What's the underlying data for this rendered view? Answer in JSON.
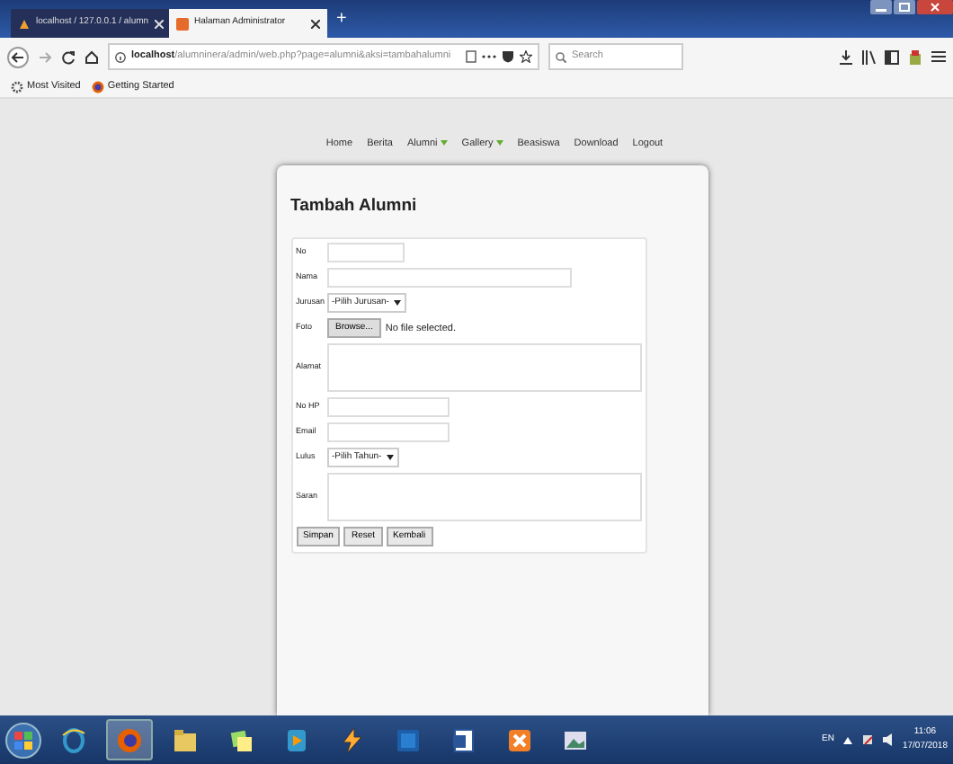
{
  "browser": {
    "tabs": [
      {
        "title": "localhost / 127.0.0.1 / alumn",
        "selected": false
      },
      {
        "title": "Halaman Administrator",
        "selected": true
      }
    ],
    "new_tab": "+",
    "address": {
      "host": "localhost",
      "path": "/alumninera/admin/web.php?page=alumni&aksi=tambahalumni"
    },
    "search": {
      "placeholder": "Search"
    },
    "bookmarks": [
      "Most Visited",
      "Getting Started"
    ]
  },
  "nav": [
    {
      "label": "Home",
      "dropdown": false
    },
    {
      "label": "Berita",
      "dropdown": false
    },
    {
      "label": "Alumni",
      "dropdown": true
    },
    {
      "label": "Gallery",
      "dropdown": true
    },
    {
      "label": "Beasiswa",
      "dropdown": false
    },
    {
      "label": "Download",
      "dropdown": false
    },
    {
      "label": "Logout",
      "dropdown": false
    }
  ],
  "form": {
    "title": "Tambah Alumni",
    "fields": [
      {
        "label": "No",
        "kind": "short"
      },
      {
        "label": "Nama",
        "kind": "long"
      },
      {
        "label": "Jurusan",
        "kind": "select",
        "value": "-Pilih Jurusan-"
      },
      {
        "label": "Foto",
        "kind": "file",
        "button": "Browse...",
        "status": "No file selected."
      },
      {
        "label": "Alamat",
        "kind": "textarea"
      },
      {
        "label": "No HP",
        "kind": "medium"
      },
      {
        "label": "Email",
        "kind": "medium"
      },
      {
        "label": "Lulus",
        "kind": "select",
        "value": "-Pilih Tahun-"
      },
      {
        "label": "Saran",
        "kind": "textarea"
      }
    ],
    "buttons": [
      "Simpan",
      "Reset",
      "Kembali"
    ]
  },
  "taskbar": {
    "apps": [
      {
        "kind": "ie",
        "selected": false
      },
      {
        "kind": "firefox",
        "selected": true
      },
      {
        "kind": "folder",
        "selected": false
      },
      {
        "kind": "notes",
        "selected": false
      },
      {
        "kind": "media",
        "selected": false
      },
      {
        "kind": "winamp",
        "selected": false
      },
      {
        "kind": "photo",
        "selected": false
      },
      {
        "kind": "word",
        "selected": false
      },
      {
        "kind": "xampp",
        "selected": false
      },
      {
        "kind": "image",
        "selected": false
      }
    ],
    "language": "EN",
    "time": "11:06",
    "date": "17/07/2018"
  }
}
